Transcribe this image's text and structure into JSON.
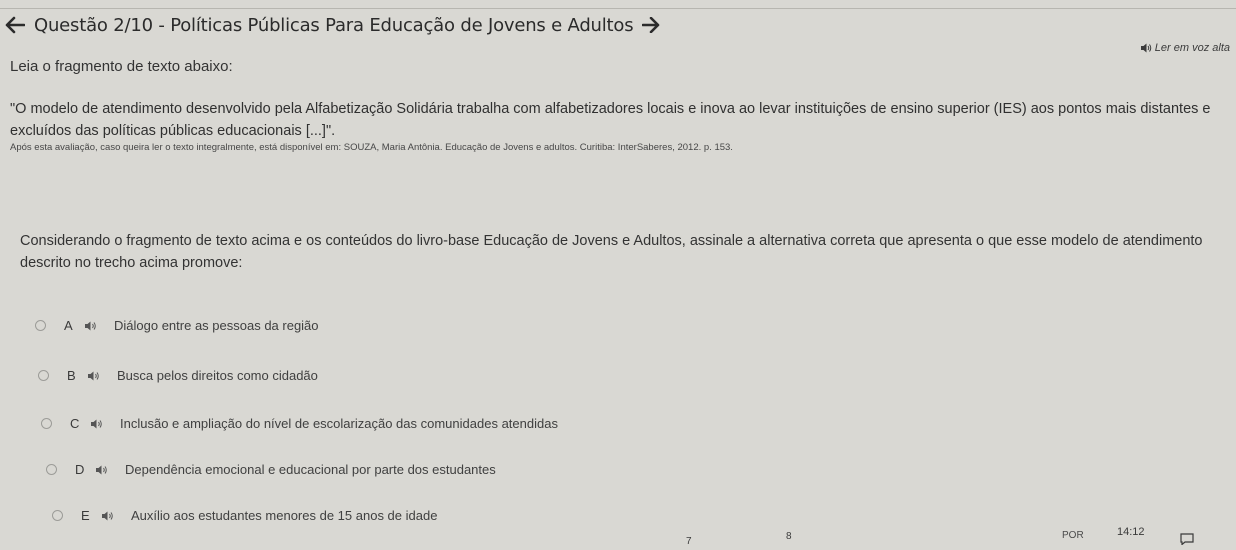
{
  "header": {
    "back_icon": "arrow-left-icon",
    "title": "Questão 2/10 - Políticas Públicas Para Educação de Jovens e Adultos",
    "next_icon": "arrow-right-icon"
  },
  "read_aloud": {
    "label": "Ler em voz alta",
    "icon": "speaker-icon"
  },
  "intro": "Leia o fragmento de texto abaixo:",
  "quote": "\"O modelo de atendimento desenvolvido pela Alfabetização Solidária trabalha com alfabetizadores locais e inova ao levar instituições de ensino superior (IES) aos pontos mais distantes e excluídos das políticas públicas educacionais [...]\".",
  "citation": "Após esta avaliação, caso queira ler o texto integralmente, está disponível em: SOUZA, Maria Antônia. Educação de Jovens e adultos. Curitiba: InterSaberes, 2012. p. 153.",
  "question": "Considerando o fragmento de texto acima e os conteúdos do livro-base Educação de Jovens e Adultos, assinale a alternativa correta que apresenta o que esse modelo de atendimento descrito no trecho acima promove:",
  "options": [
    {
      "letter": "A",
      "text": "Diálogo entre as pessoas da região"
    },
    {
      "letter": "B",
      "text": "Busca pelos direitos como cidadão"
    },
    {
      "letter": "C",
      "text": "Inclusão e ampliação do nível de escolarização das comunidades atendidas"
    },
    {
      "letter": "D",
      "text": "Dependência emocional e educacional por parte dos estudantes"
    },
    {
      "letter": "E",
      "text": "Auxílio aos estudantes menores de 15 anos de idade"
    }
  ],
  "taskbar": {
    "nums": [
      "7",
      "8"
    ],
    "lang": "POR",
    "time": "14:12"
  },
  "colors": {
    "background": "#d9d8d3",
    "text": "#2f2f2f"
  }
}
